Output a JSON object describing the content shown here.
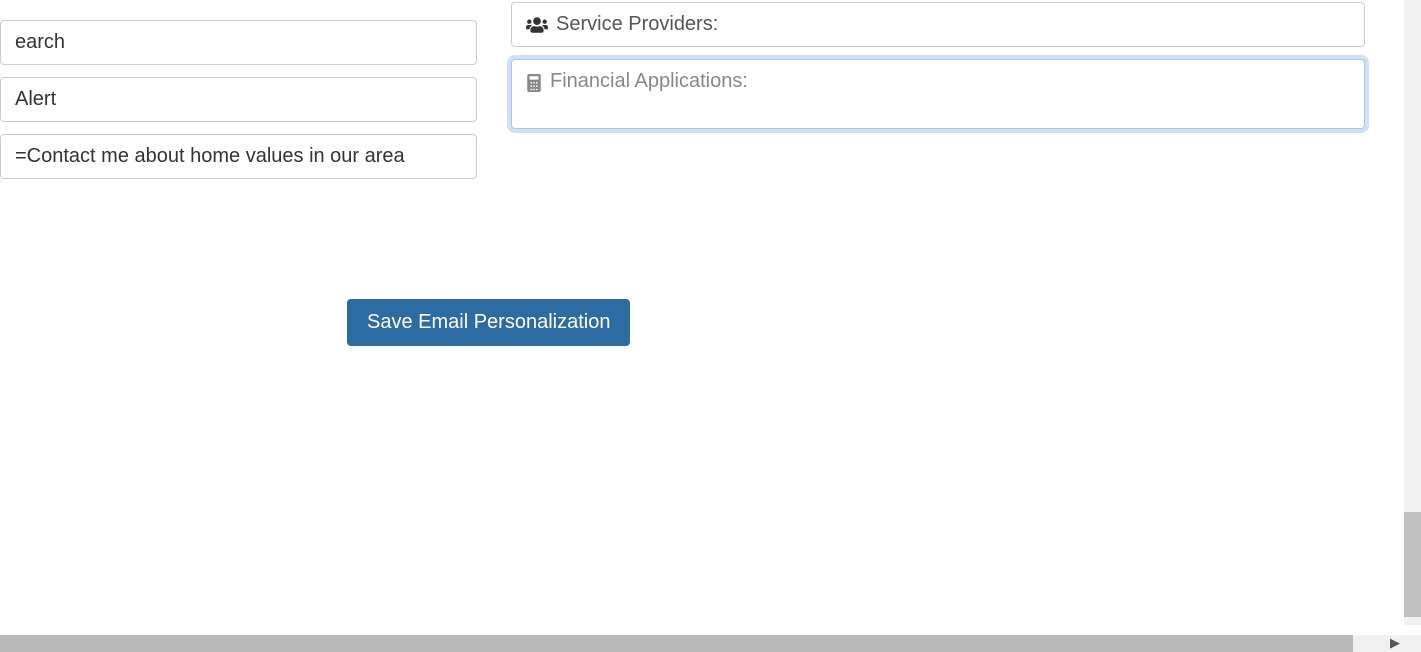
{
  "left": {
    "field1": "earch",
    "field2": "Alert",
    "field3": "=Contact me about home values in our area"
  },
  "right": {
    "service_providers_label": "Service Providers:",
    "financial_applications_label": "Financial Applications:"
  },
  "save_button_label": "Save Email Personalization"
}
